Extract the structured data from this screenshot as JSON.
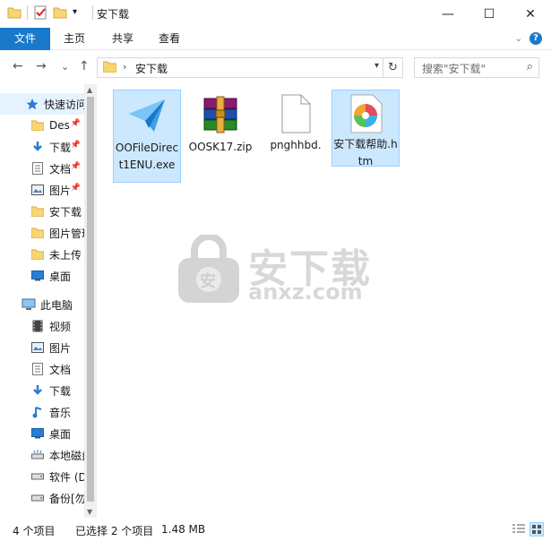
{
  "window": {
    "title": "安下载",
    "minimize": "—",
    "maximize": "☐",
    "close": "✕"
  },
  "ribbon": {
    "tabs": [
      "文件",
      "主页",
      "共享",
      "查看"
    ],
    "help": "?"
  },
  "nav": {
    "back": "←",
    "forward": "→",
    "recent": "⌄",
    "up": "↑",
    "breadcrumb_sep": "›",
    "path": "安下载",
    "refresh": "↻",
    "search_placeholder": "搜索\"安下载\""
  },
  "sidebar": {
    "items": [
      {
        "label": "快速访问",
        "icon": "star-icon",
        "selected": true,
        "pinned": false
      },
      {
        "label": "Des",
        "icon": "folder-icon",
        "pinned": true
      },
      {
        "label": "下载",
        "icon": "download-icon",
        "pinned": true
      },
      {
        "label": "文档",
        "icon": "document-icon",
        "pinned": true
      },
      {
        "label": "图片",
        "icon": "picture-icon",
        "pinned": true
      },
      {
        "label": "安下载",
        "icon": "folder-icon",
        "pinned": false
      },
      {
        "label": "图片管理",
        "icon": "folder-icon",
        "pinned": false
      },
      {
        "label": "未上传",
        "icon": "folder-icon",
        "pinned": false
      },
      {
        "label": "桌面",
        "icon": "desktop-icon",
        "pinned": false
      },
      {
        "label": "此电脑",
        "icon": "computer-icon",
        "pinned": false
      },
      {
        "label": "视频",
        "icon": "video-icon",
        "pinned": false
      },
      {
        "label": "图片",
        "icon": "picture-icon",
        "pinned": false
      },
      {
        "label": "文档",
        "icon": "document-icon",
        "pinned": false
      },
      {
        "label": "下载",
        "icon": "download-icon",
        "pinned": false
      },
      {
        "label": "音乐",
        "icon": "music-icon",
        "pinned": false
      },
      {
        "label": "桌面",
        "icon": "desktop-icon",
        "pinned": false
      },
      {
        "label": "本地磁盘",
        "icon": "drive-icon",
        "pinned": false
      },
      {
        "label": "软件 (D",
        "icon": "drive-icon",
        "pinned": false
      },
      {
        "label": "备份[勿",
        "icon": "drive-icon",
        "pinned": false
      }
    ]
  },
  "files": [
    {
      "name": "OOFileDirect1ENU.exe",
      "icon": "exe-app-icon",
      "selected": true
    },
    {
      "name": "OOSK17.zip",
      "icon": "winrar-archive-icon",
      "selected": false
    },
    {
      "name": "pnghhbd.",
      "icon": "blank-file-icon",
      "selected": false
    },
    {
      "name": "安下载帮助.htm",
      "icon": "htm-file-icon",
      "selected": true
    }
  ],
  "watermark": {
    "cn": "安下载",
    "en": "anxz.com",
    "badge": "安"
  },
  "status": {
    "count": "4 个项目",
    "selection": "已选择 2 个项目",
    "size": "1.48 MB"
  },
  "colors": {
    "accent": "#1979ca",
    "selection_bg": "#cce8ff",
    "selection_border": "#99d1ff",
    "folder": "#f7d674"
  }
}
